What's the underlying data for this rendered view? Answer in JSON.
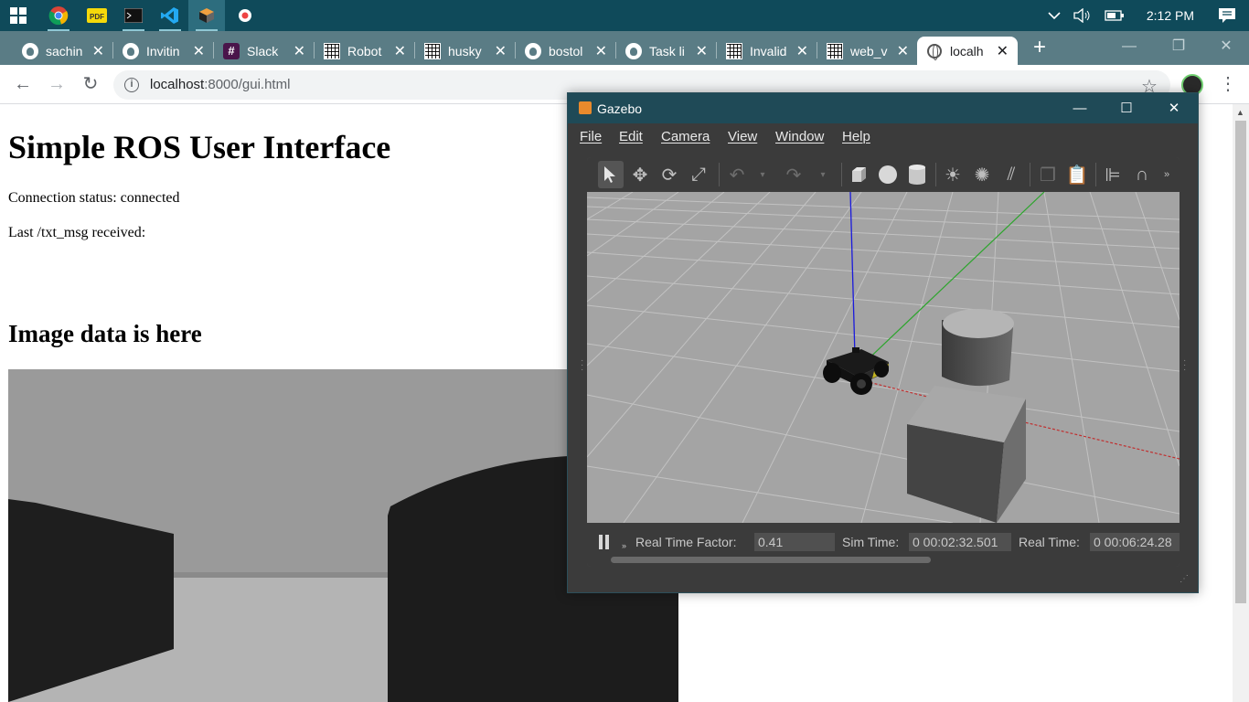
{
  "taskbar": {
    "apps": [
      "windows-start",
      "chrome",
      "pdf-reader",
      "terminal",
      "vscode",
      "gazebo",
      "record"
    ],
    "clock": "2:12 PM"
  },
  "browser": {
    "tabs": [
      {
        "icon": "github",
        "title": "sachin"
      },
      {
        "icon": "github",
        "title": "Invitin"
      },
      {
        "icon": "slack",
        "title": "Slack"
      },
      {
        "icon": "grid",
        "title": "Robot"
      },
      {
        "icon": "grid",
        "title": "husky"
      },
      {
        "icon": "github",
        "title": "bostol"
      },
      {
        "icon": "github",
        "title": "Task li"
      },
      {
        "icon": "grid",
        "title": "Invalid"
      },
      {
        "icon": "grid",
        "title": "web_v"
      },
      {
        "icon": "globe",
        "title": "localh"
      }
    ],
    "url_host": "localhost",
    "url_path": ":8000/gui.html"
  },
  "page": {
    "title": "Simple ROS User Interface",
    "connection_status": "Connection status: connected",
    "last_msg": "Last /txt_msg received:",
    "image_heading": "Image data is here"
  },
  "gazebo": {
    "window_title": "Gazebo",
    "menu": [
      "File",
      "Edit",
      "Camera",
      "View",
      "Window",
      "Help"
    ],
    "real_time_factor_label": "Real Time Factor:",
    "real_time_factor": "0.41",
    "sim_time_label": "Sim Time:",
    "sim_time": "0 00:02:32.501",
    "real_time_label": "Real Time:",
    "real_time": "0 00:06:24.28"
  }
}
